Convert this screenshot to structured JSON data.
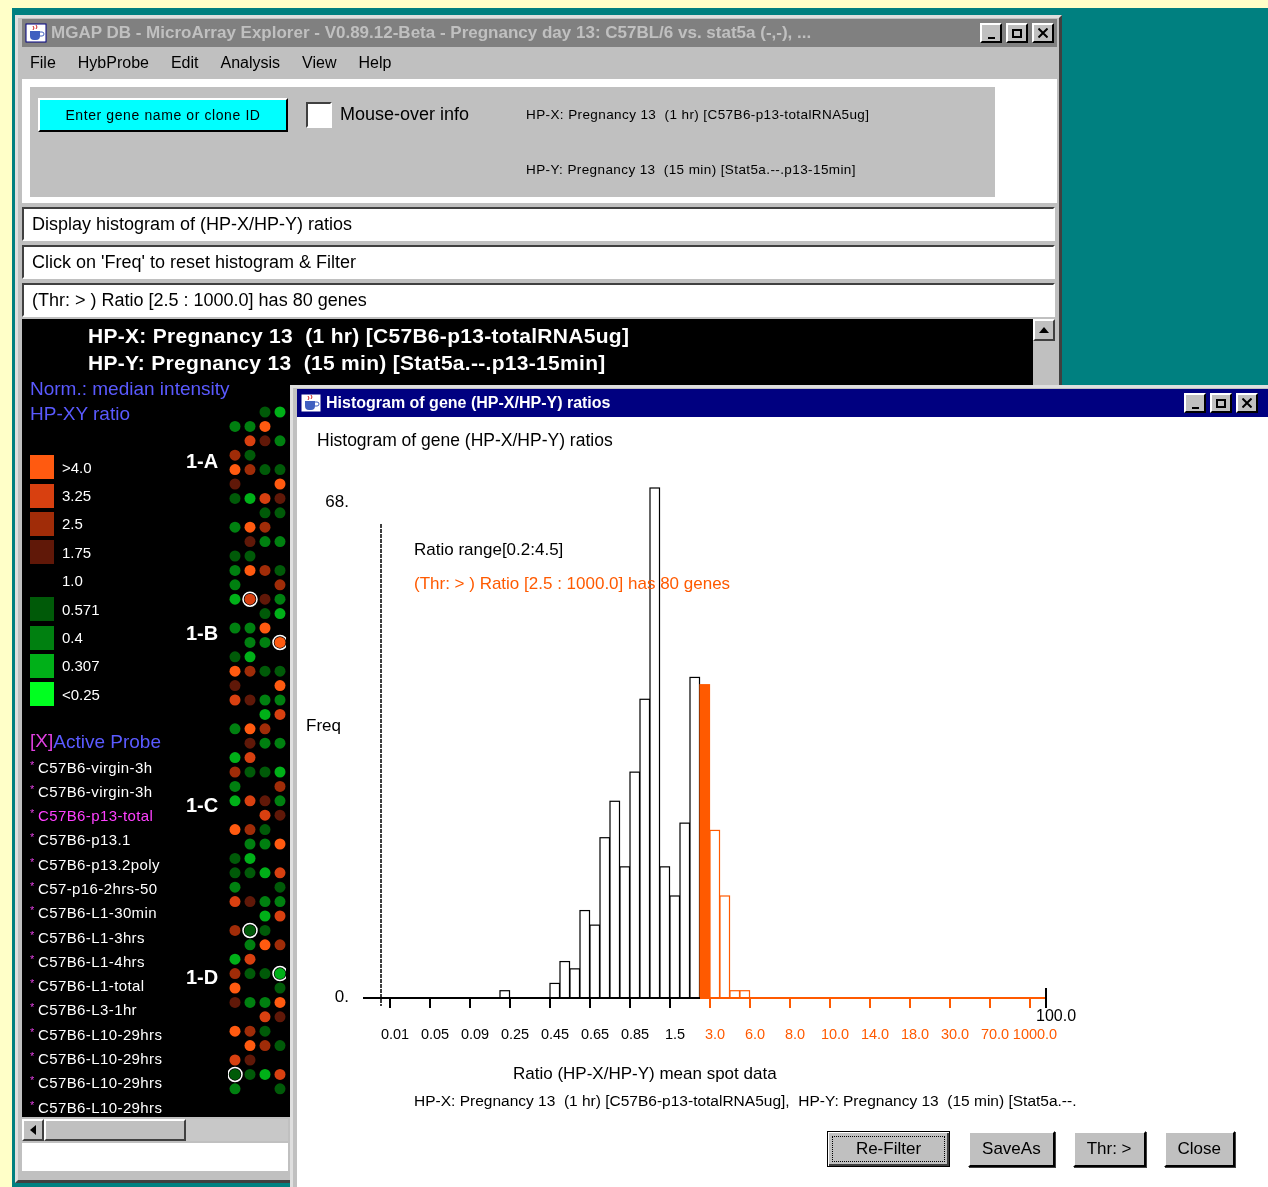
{
  "main_window": {
    "title": "MGAP DB - MicroArray Explorer - V0.89.12-Beta - Pregnancy day 13: C57BL/6 vs. stat5a (-,-), ...",
    "active": false,
    "menu": [
      "File",
      "HybProbe",
      "Edit",
      "Analysis",
      "View",
      "Help"
    ],
    "toolbar": {
      "search_button": "Enter gene name or clone ID",
      "mouse_over": {
        "label": "Mouse-over info",
        "checked": false
      },
      "probe_x": "HP-X: Pregnancy 13  (1 hr) [C57B6-p13-totalRNA5ug]",
      "probe_y": "HP-Y: Pregnancy 13  (15 min) [Stat5a.--.p13-15min]"
    },
    "messages": [
      "Display histogram of (HP-X/HP-Y) ratios",
      "Click on 'Freq' to reset histogram & Filter",
      "(Thr: > ) Ratio [2.5 : 1000.0] has 80 genes"
    ],
    "canvas": {
      "headers": [
        "HP-X: Pregnancy 13  (1 hr) [C57B6-p13-totalRNA5ug]",
        "HP-Y: Pregnancy 13  (15 min) [Stat5a.--.p13-15min]"
      ],
      "normalization": "Norm.: median intensity",
      "ratio_title": "HP-XY ratio",
      "legend": [
        {
          "label": ">4.0",
          "color": "#ff5a10"
        },
        {
          "label": "3.25",
          "color": "#d84010"
        },
        {
          "label": "2.5",
          "color": "#a02c08"
        },
        {
          "label": "1.75",
          "color": "#601808"
        },
        {
          "label": "1.0"
        },
        {
          "label": "0.571",
          "color": "#005a08"
        },
        {
          "label": "0.4",
          "color": "#008010"
        },
        {
          "label": "0.307",
          "color": "#00b018"
        },
        {
          "label": "<0.25",
          "color": "#00ff20"
        }
      ],
      "probe_heading": {
        "mark": "[X]",
        "label": "Active Probe"
      },
      "probes": [
        {
          "bullet": "*",
          "name": "C57B6-virgin-3h",
          "selected": false
        },
        {
          "bullet": "*",
          "name": "C57B6-virgin-3h",
          "selected": false
        },
        {
          "bullet": "*",
          "name": "C57B6-p13-total",
          "selected": true
        },
        {
          "bullet": "*",
          "name": "C57B6-p13.1",
          "selected": false
        },
        {
          "bullet": "*",
          "name": "C57B6-p13.2poly",
          "selected": false
        },
        {
          "bullet": "*",
          "name": "C57-p16-2hrs-50",
          "selected": false
        },
        {
          "bullet": "*",
          "name": "C57B6-L1-30min",
          "selected": false
        },
        {
          "bullet": "*",
          "name": "C57B6-L1-3hrs",
          "selected": false
        },
        {
          "bullet": "*",
          "name": "C57B6-L1-4hrs",
          "selected": false
        },
        {
          "bullet": "*",
          "name": "C57B6-L1-total",
          "selected": false
        },
        {
          "bullet": "*",
          "name": "C57B6-L3-1hr",
          "selected": false
        },
        {
          "bullet": "*",
          "name": "C57B6-L10-29hrs",
          "selected": false
        },
        {
          "bullet": "*",
          "name": "C57B6-L10-29hrs",
          "selected": false
        },
        {
          "bullet": "*",
          "name": "C57B6-L10-29hrs",
          "selected": false
        },
        {
          "bullet": "*",
          "name": "C57B6-L10-29hrs",
          "selected": false
        }
      ],
      "blocks": [
        "1-A",
        "1-B",
        "1-C",
        "1-D"
      ]
    }
  },
  "histogram_window": {
    "title": "Histogram of gene (HP-X/HP-Y) ratios",
    "active": true,
    "chart_data": {
      "type": "bar",
      "title": "Histogram of gene (HP-X/HP-Y) ratios",
      "xlabel": "Ratio (HP-X/HP-Y) mean spot data",
      "ylabel": "Freq",
      "categories": [
        "0.01",
        null,
        null,
        null,
        "0.05",
        null,
        null,
        null,
        "0.09",
        null,
        null,
        null,
        "0.25",
        null,
        null,
        null,
        "0.45",
        null,
        null,
        null,
        "0.65",
        null,
        null,
        null,
        "0.85",
        null,
        null,
        null,
        "1.5",
        null,
        null,
        null,
        "3.0",
        null,
        null,
        null,
        "6.0",
        null,
        null,
        null,
        "8.0",
        null,
        null,
        null,
        "10.0",
        null,
        null,
        null,
        "14.0",
        null,
        null,
        null,
        "18.0",
        null,
        null,
        null,
        "30.0",
        null,
        null,
        null,
        "70.0",
        null,
        null,
        null,
        "1000.0"
      ],
      "series": [
        {
          "color": "#000000",
          "values": [
            null,
            null,
            null,
            null,
            null,
            null,
            null,
            null,
            null,
            null,
            null,
            1,
            null,
            null,
            null,
            null,
            2,
            5,
            4,
            12,
            10,
            22,
            27,
            18,
            31,
            41,
            70,
            18,
            14,
            24,
            44,
            null,
            null,
            null,
            null,
            null,
            null,
            null,
            null,
            null,
            null,
            null,
            null,
            null,
            null,
            null,
            null,
            null,
            null,
            null,
            null,
            null,
            null,
            null,
            null,
            null,
            null,
            null,
            null,
            null,
            null,
            null,
            null,
            null,
            null
          ]
        },
        {
          "color": "#ff5a00",
          "values": [
            null,
            null,
            null,
            null,
            null,
            null,
            null,
            null,
            null,
            null,
            null,
            null,
            null,
            null,
            null,
            null,
            null,
            null,
            null,
            null,
            null,
            null,
            null,
            null,
            null,
            null,
            null,
            null,
            null,
            null,
            null,
            43,
            23,
            14,
            1,
            1,
            null,
            null,
            null,
            null,
            null,
            null,
            null,
            null,
            null,
            null,
            null,
            null,
            null,
            null,
            null,
            null,
            null,
            null,
            null,
            null,
            null,
            null,
            null,
            null,
            null,
            null,
            null,
            null,
            null
          ]
        }
      ],
      "ylim": [
        0,
        70
      ],
      "yticks": [
        {
          "value": 0,
          "label": "0."
        },
        {
          "value": 68,
          "label": "68."
        }
      ],
      "annotations": [
        "Ratio range[0.2:4.5]",
        "(Thr: > ) Ratio [2.5 : 1000.0] has 80 genes"
      ]
    },
    "axis_end_label": "100.0",
    "caption": "HP-X: Pregnancy 13  (1 hr) [C57B6-p13-totalRNA5ug],  HP-Y: Pregnancy 13  (15 min) [Stat5a.--.",
    "buttons": [
      {
        "label": "Re-Filter",
        "focused": true
      },
      {
        "label": "SaveAs",
        "focused": false
      },
      {
        "label": "Thr: >",
        "focused": false
      },
      {
        "label": "Close",
        "focused": false
      }
    ]
  }
}
